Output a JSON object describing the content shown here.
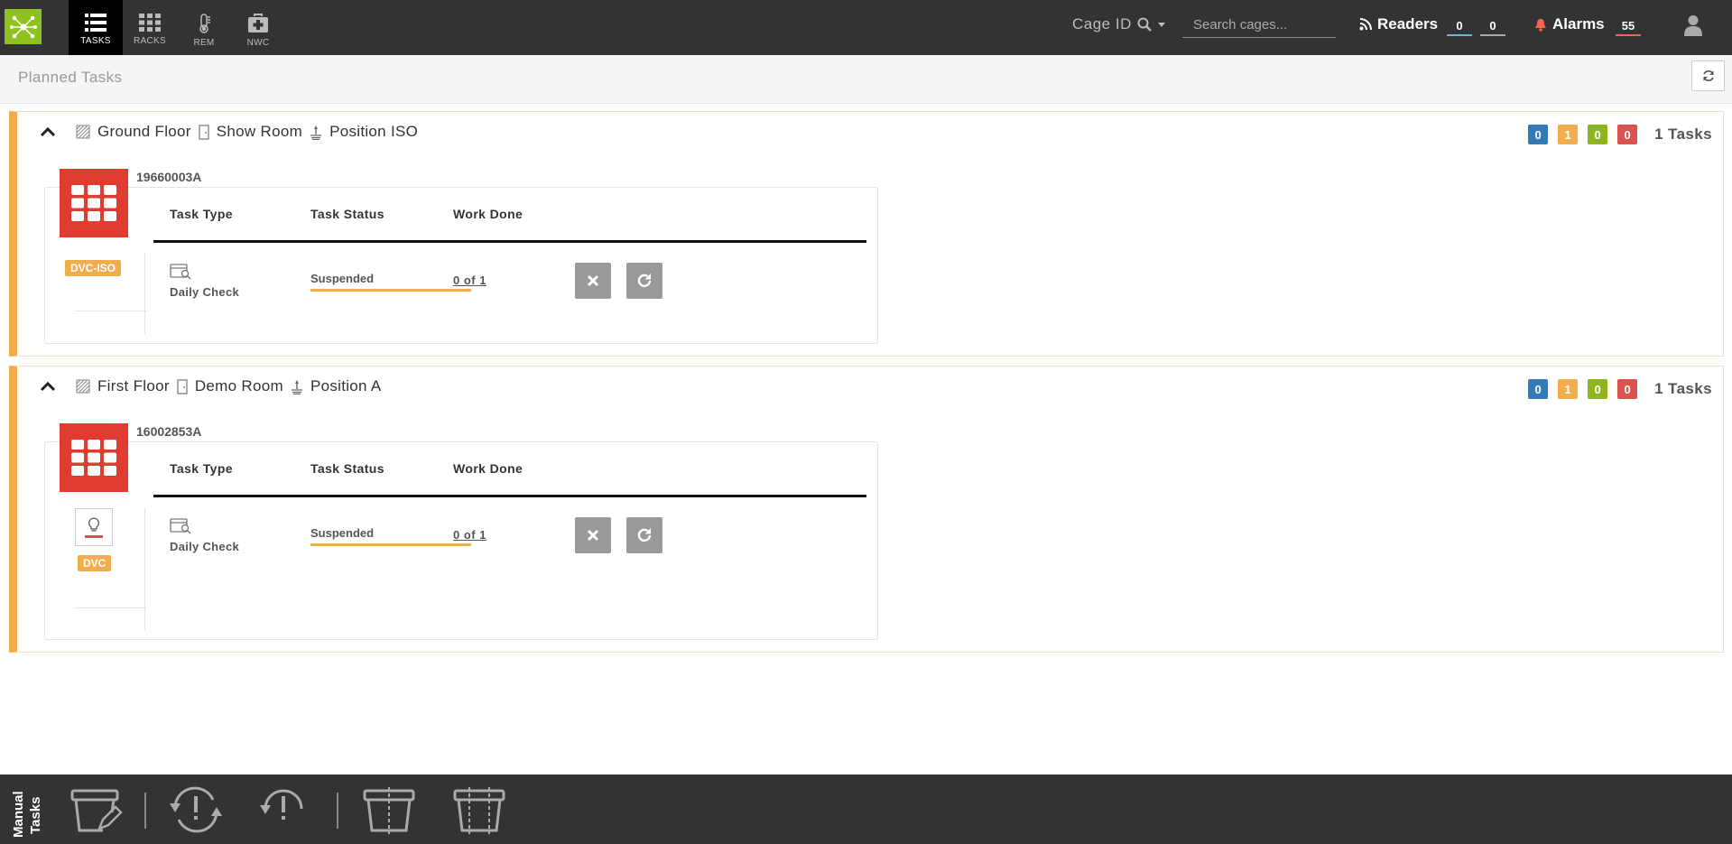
{
  "nav": {
    "items": [
      {
        "label": "TASKS",
        "icon": "list-icon"
      },
      {
        "label": "RACKS",
        "icon": "grid-icon"
      },
      {
        "label": "REM",
        "icon": "thermometer-icon"
      },
      {
        "label": "NWC",
        "icon": "medkit-icon"
      }
    ],
    "cage_id_label": "Cage ID",
    "search_placeholder": "Search cages...",
    "readers_label": "Readers",
    "readers_count_1": "0",
    "readers_count_2": "0",
    "alarms_label": "Alarms",
    "alarms_count": "55"
  },
  "subheader": {
    "title": "Planned Tasks"
  },
  "groups": [
    {
      "floor": "Ground Floor",
      "room": "Show Room",
      "position": "Position ISO",
      "badges": [
        "0",
        "1",
        "0",
        "0"
      ],
      "tasks_label": "1 Tasks",
      "cage_id": "19660003A",
      "tag": "DVC-ISO",
      "headers": {
        "type": "Task Type",
        "status": "Task Status",
        "work": "Work Done"
      },
      "task": {
        "type": "Daily Check",
        "status": "Suspended",
        "work": "0 of 1"
      }
    },
    {
      "floor": "First Floor",
      "room": "Demo Room",
      "position": "Position A",
      "badges": [
        "0",
        "1",
        "0",
        "0"
      ],
      "tasks_label": "1 Tasks",
      "cage_id": "16002853A",
      "tag": "DVC",
      "headers": {
        "type": "Task Type",
        "status": "Task Status",
        "work": "Work Done"
      },
      "task": {
        "type": "Daily Check",
        "status": "Suspended",
        "work": "0 of 1"
      }
    }
  ],
  "bottombar": {
    "label_line1": "Manual",
    "label_line2": "Tasks"
  },
  "colors": {
    "navbar": "#333333",
    "brand": "#8ec21f",
    "accent_orange": "#f0ad4e",
    "cage_red": "#e03c31",
    "badge_blue": "#337ab7",
    "badge_green": "#8cb51e",
    "badge_red": "#d9534f"
  }
}
